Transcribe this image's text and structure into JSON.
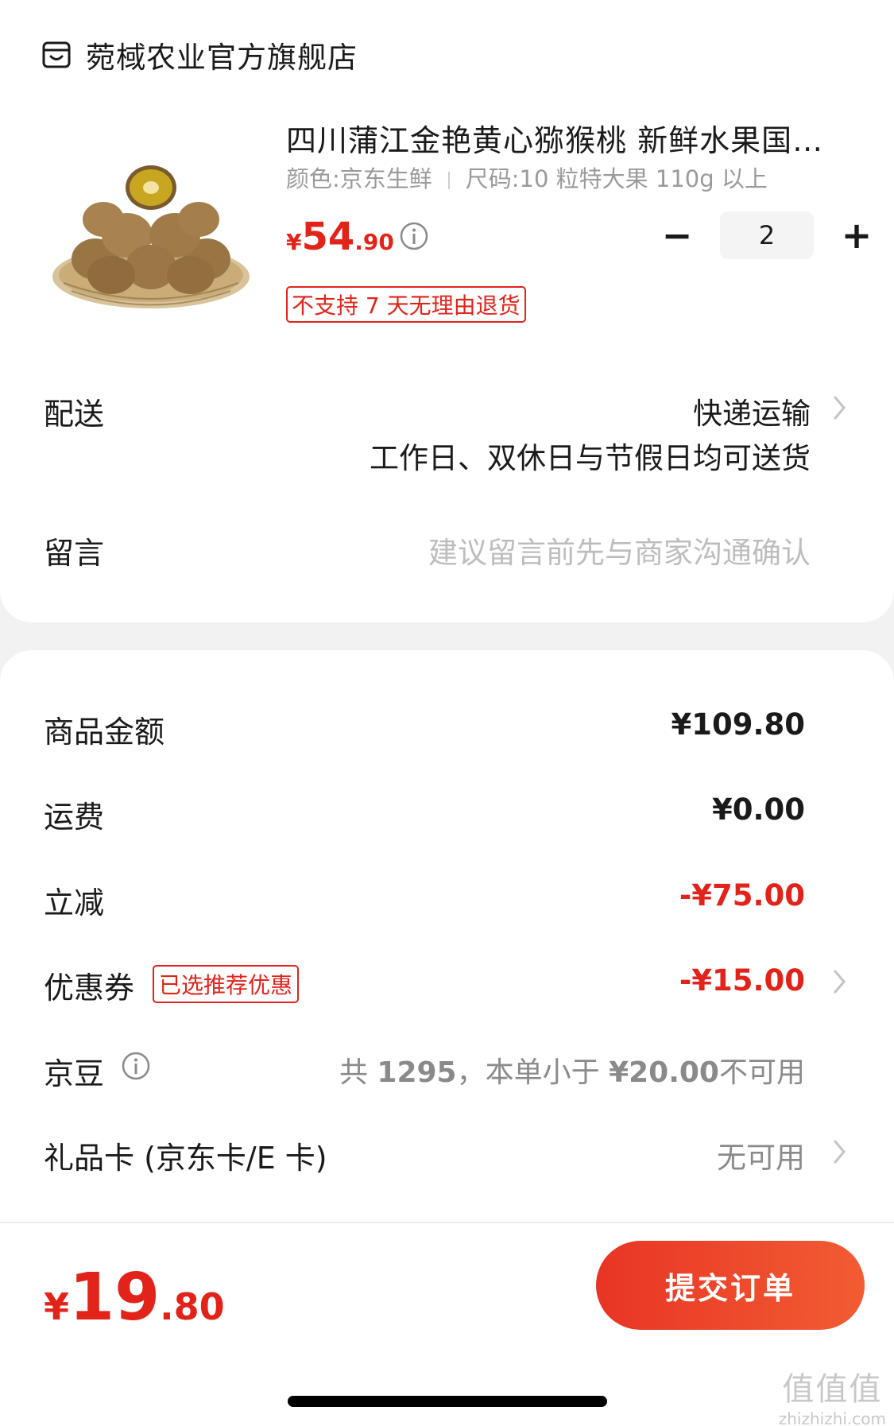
{
  "shop": {
    "name": "菀棫农业官方旗舰店",
    "icon": "shop-icon"
  },
  "product": {
    "title": "四川蒲江金艳黄心猕猴桃 新鲜水果国…",
    "spec_color": "颜色:京东生鲜",
    "spec_size": "尺码:10 粒特大果 110g 以上",
    "price_yen": "¥",
    "price_int": "54",
    "price_dec": ".90",
    "quantity": "2",
    "minus_label": "−",
    "plus_label": "+",
    "return_policy": "不支持 7 天无理由退货"
  },
  "delivery": {
    "label": "配送",
    "method": "快递运输",
    "schedule": "工作日、双休日与节假日均可送货"
  },
  "message": {
    "label": "留言",
    "placeholder": "建议留言前先与商家沟通确认"
  },
  "summary": {
    "goods_label": "商品金额",
    "goods_value": "¥109.80",
    "shipping_label": "运费",
    "shipping_value": "¥0.00",
    "discount_label": "立减",
    "discount_value": "-¥75.00",
    "coupon_label": "优惠券",
    "coupon_tag": "已选推荐优惠",
    "coupon_value": "-¥15.00",
    "jd_label": "京豆",
    "jd_prefix": "共 ",
    "jd_count": "1295",
    "jd_mid": "，本单小于 ",
    "jd_threshold": "¥20.00",
    "jd_suffix": "不可用",
    "gift_label": "礼品卡 (京东卡/E 卡)",
    "gift_value": "无可用"
  },
  "footer": {
    "total_yen": "¥",
    "total_int": "19",
    "total_dec": ".80",
    "submit_label": "提交订单"
  },
  "watermark": {
    "logo": "值值值",
    "site": "zhizhizhi.com"
  },
  "colors": {
    "accent": "#e2231a",
    "button_start": "#e83524",
    "button_end": "#f25c33"
  }
}
